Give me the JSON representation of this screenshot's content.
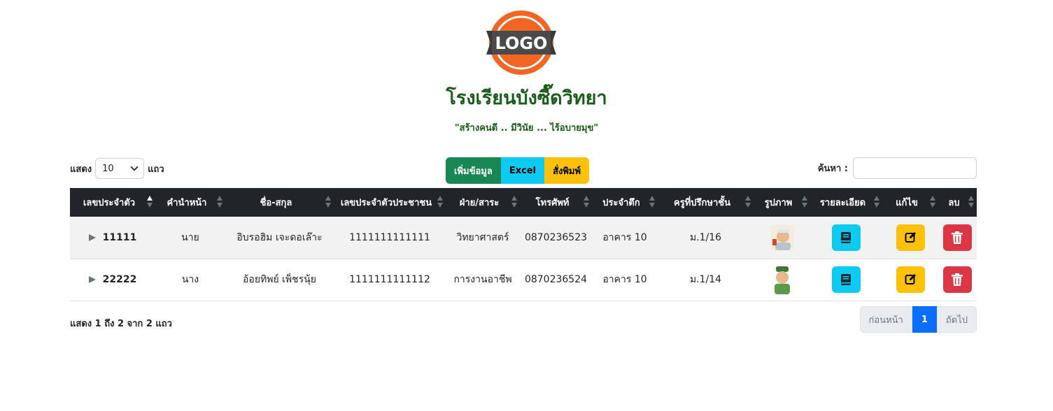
{
  "logo": {
    "text": "LOGO"
  },
  "school": {
    "name": "โรงเรียนบังซี๊ดวิทยา",
    "motto": "\"สร้างคนดี .. มีวินัย ... ไร้อบายมุข\""
  },
  "length_menu": {
    "prefix": "แสดง",
    "value": "10",
    "suffix": "แถว"
  },
  "buttons": {
    "add": "เพิ่มข้อมูล",
    "excel": "Excel",
    "print": "สั่งพิมพ์"
  },
  "search": {
    "label": "ค้นหา :",
    "value": ""
  },
  "table": {
    "headers": [
      "เลขประจำตัว",
      "คำนำหน้า",
      "ชื่อ-สกุล",
      "เลขประจำตัวประชาชน",
      "ฝ่าย/สาระ",
      "โทรศัพท์",
      "ประจำตึก",
      "ครูที่ปรึกษาชั้น",
      "รูปภาพ",
      "รายละเอียด",
      "แก้ไข",
      "ลบ"
    ],
    "rows": [
      {
        "id": "11111",
        "prefix": "นาย",
        "name": "อิบรอฮิม เจะดอเล๊าะ",
        "citizen_id": "1111111111111",
        "dept": "วิทยาศาสตร์",
        "phone": "0870236523",
        "building": "อาคาร 10",
        "class": "ม.1/16"
      },
      {
        "id": "22222",
        "prefix": "นาง",
        "name": "อ้อยทิพย์ เพ็ชรนุ้ย",
        "citizen_id": "1111111111112",
        "dept": "การงานอาชีพ",
        "phone": "0870236524",
        "building": "อาคาร 10",
        "class": "ม.1/14"
      }
    ]
  },
  "footer": {
    "info": "แสดง 1 ถึง 2 จาก 2 แถว",
    "prev": "ก่อนหน้า",
    "page": "1",
    "next": "ถัดไป"
  },
  "colors": {
    "primary": "#0d6efd",
    "success": "#198754",
    "info": "#0dcaf0",
    "warning": "#ffc107",
    "danger": "#dc3545",
    "dark": "#212529",
    "title": "#1a5c1a"
  }
}
